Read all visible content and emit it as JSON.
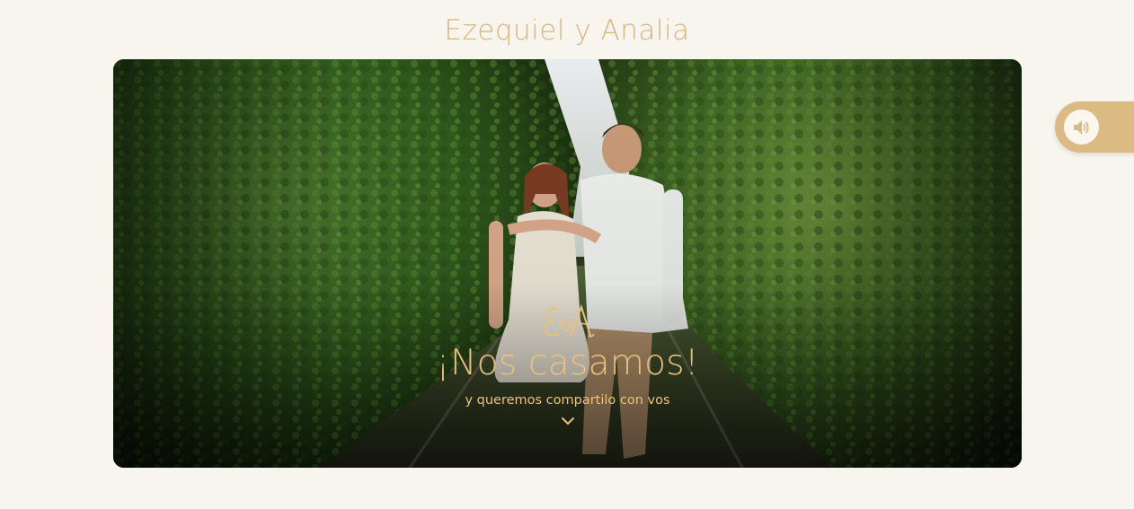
{
  "header": {
    "title": "Ezequiel y Analia"
  },
  "hero": {
    "monogram": "E&A",
    "heading": "¡Nos casamos!",
    "subtitle": "y queremos compartilo con vos",
    "scroll_icon": "chevron-down-icon",
    "accent_color": "#e9c27f"
  },
  "audio": {
    "icon": "speaker-volume-icon",
    "tab_color": "#dcba84"
  },
  "colors": {
    "background": "#f8f5ef",
    "title": "#d8b47f"
  }
}
